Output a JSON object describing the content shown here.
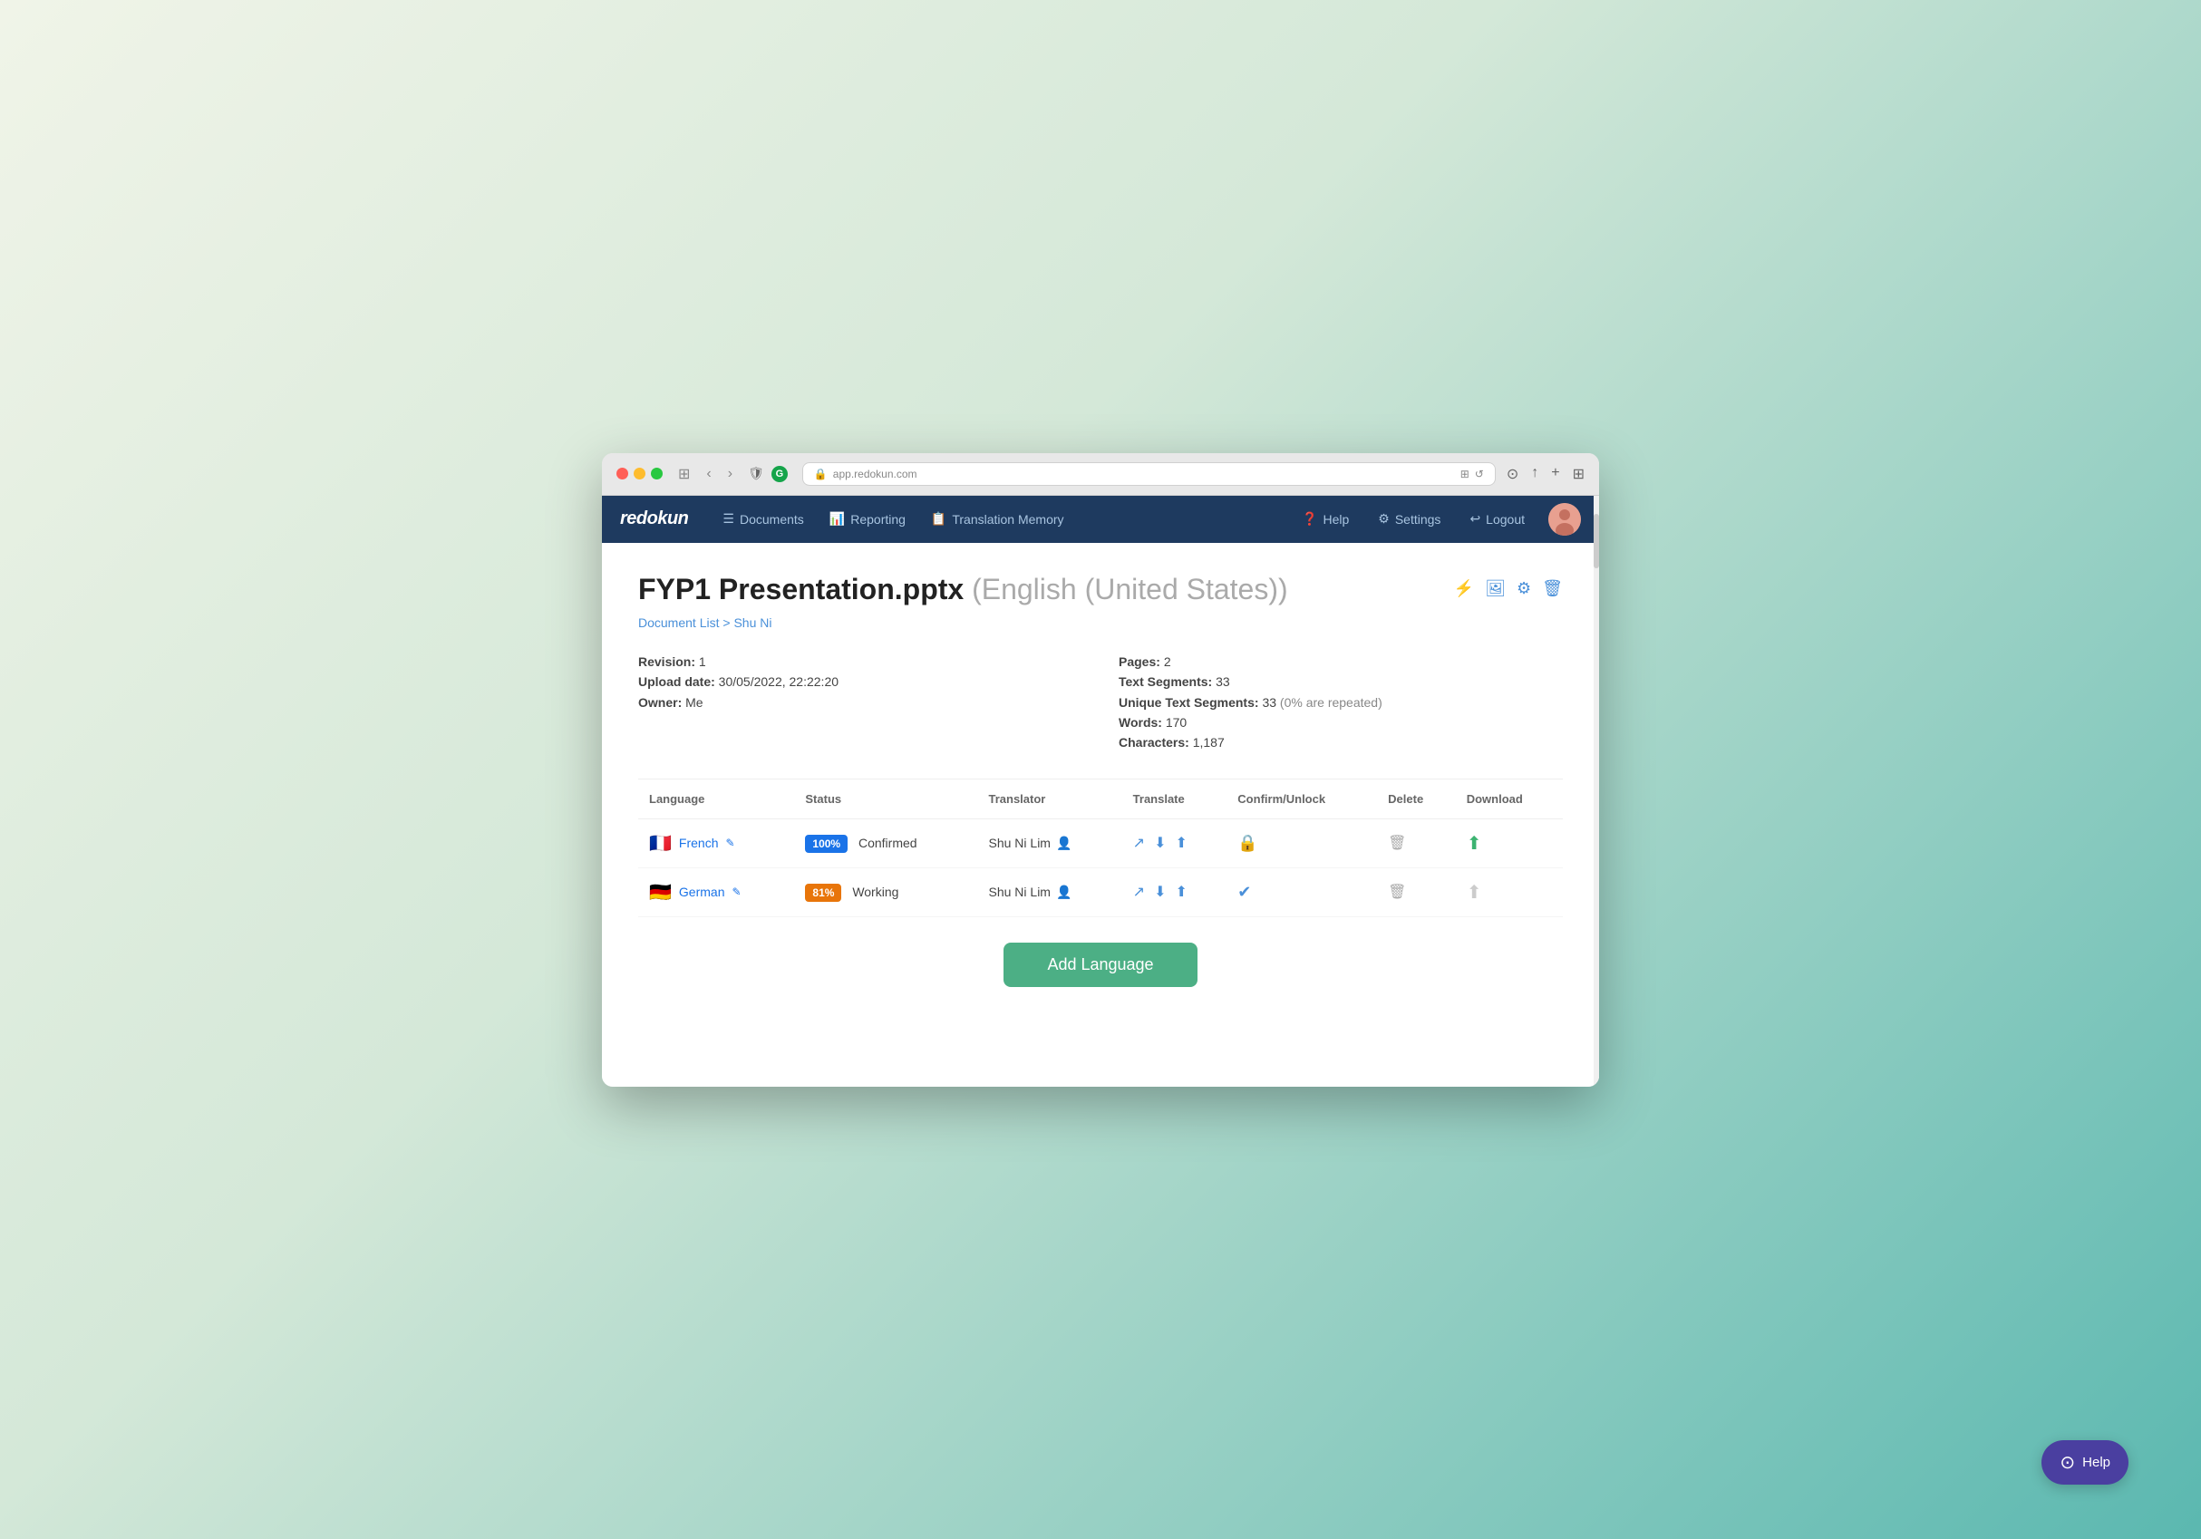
{
  "browser": {
    "address": "app.redokun.com",
    "address_icon": "🔒"
  },
  "nav": {
    "logo": "redokun",
    "items": [
      {
        "id": "documents",
        "label": "Documents",
        "icon": "☰"
      },
      {
        "id": "reporting",
        "label": "Reporting",
        "icon": "📊"
      },
      {
        "id": "translation-memory",
        "label": "Translation Memory",
        "icon": "📋"
      }
    ],
    "right_items": [
      {
        "id": "help",
        "label": "Help",
        "icon": "❓"
      },
      {
        "id": "settings",
        "label": "Settings",
        "icon": "⚙"
      },
      {
        "id": "logout",
        "label": "Logout",
        "icon": "↩"
      }
    ]
  },
  "page": {
    "title": "FYP1 Presentation.pptx",
    "subtitle": "(English (United States))",
    "breadcrumb": {
      "document_list": "Document List",
      "separator": ">",
      "owner": "Shu Ni"
    },
    "meta": {
      "revision_label": "Revision:",
      "revision_value": "1",
      "upload_date_label": "Upload date:",
      "upload_date_value": "30/05/2022, 22:22:20",
      "owner_label": "Owner:",
      "owner_value": "Me",
      "pages_label": "Pages:",
      "pages_value": "2",
      "text_segments_label": "Text Segments:",
      "text_segments_value": "33",
      "unique_segments_label": "Unique Text Segments:",
      "unique_segments_value": "33",
      "unique_segments_note": "(0% are repeated)",
      "words_label": "Words:",
      "words_value": "170",
      "characters_label": "Characters:",
      "characters_value": "1,187"
    },
    "table": {
      "headers": {
        "language": "Language",
        "status": "Status",
        "translator": "Translator",
        "translate": "Translate",
        "confirm_unlock": "Confirm/Unlock",
        "delete": "Delete",
        "download": "Download"
      },
      "rows": [
        {
          "id": "french",
          "flag": "🇫🇷",
          "language": "French",
          "percentage": "100%",
          "status_text": "Confirmed",
          "translator": "Shu Ni Lim",
          "confirm_type": "locked"
        },
        {
          "id": "german",
          "flag": "🇩🇪",
          "language": "German",
          "percentage": "81%",
          "status_text": "Working",
          "translator": "Shu Ni Lim",
          "confirm_type": "check"
        }
      ]
    },
    "add_language_button": "Add Language"
  },
  "help": {
    "label": "Help"
  }
}
